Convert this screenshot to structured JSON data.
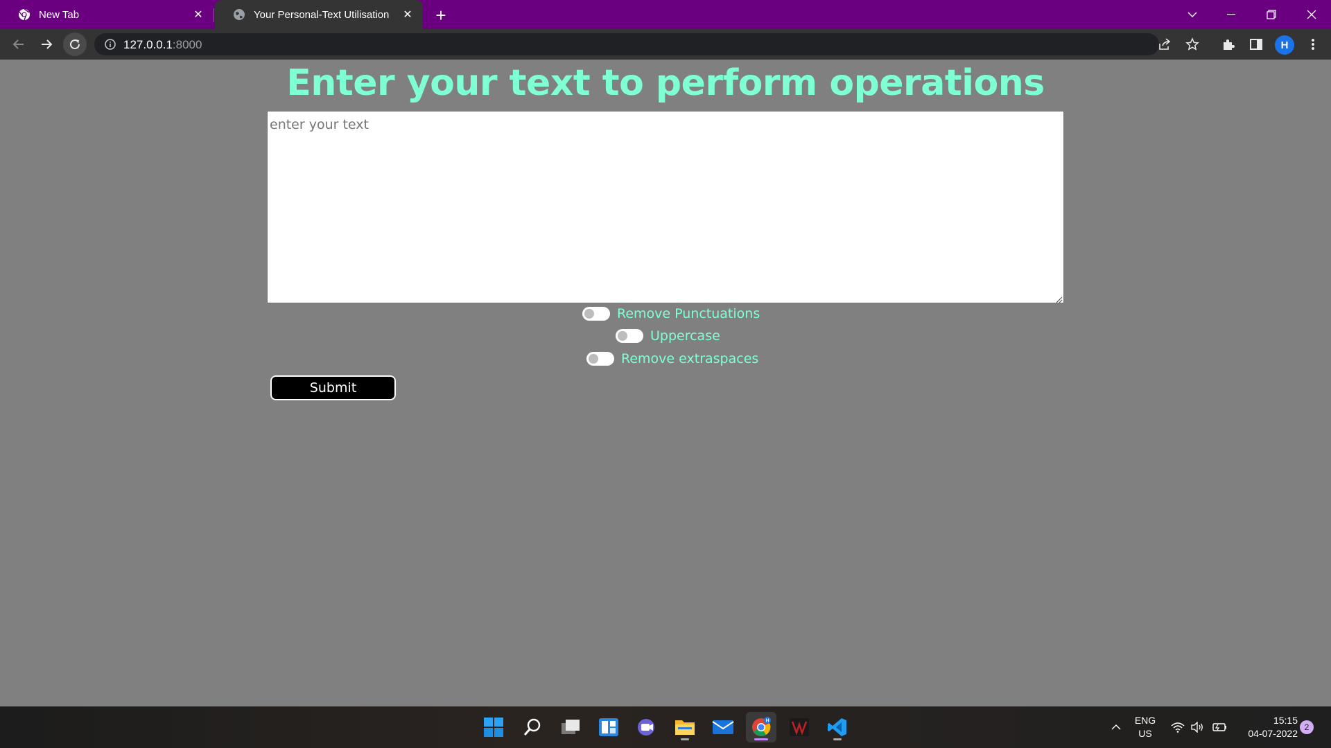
{
  "browser": {
    "tabs": [
      {
        "title": "New Tab",
        "active": false
      },
      {
        "title": "Your Personal-Text Utilisation",
        "active": true
      }
    ],
    "url_host": "127.0.0.1",
    "url_port": ":8000",
    "profile_initial": "H",
    "accent_color": "#6a0080"
  },
  "page": {
    "heading": "Enter your text to perform operations",
    "textarea_placeholder": "enter your text",
    "textarea_value": "",
    "options": [
      {
        "label": "Remove Punctuations",
        "checked": false
      },
      {
        "label": "Uppercase",
        "checked": false
      },
      {
        "label": "Remove extraspaces",
        "checked": false
      }
    ],
    "submit_label": "Submit",
    "heading_color": "#7fffd4",
    "background_color": "#808080"
  },
  "taskbar": {
    "apps": [
      "start-icon",
      "search-icon",
      "task-view-icon",
      "widgets-icon",
      "chat-icon",
      "file-explorer-icon",
      "mail-icon",
      "chrome-icon",
      "game-app-icon",
      "vscode-icon"
    ],
    "language_line1": "ENG",
    "language_line2": "US",
    "time": "15:15",
    "date": "04-07-2022",
    "notification_count": "2"
  }
}
